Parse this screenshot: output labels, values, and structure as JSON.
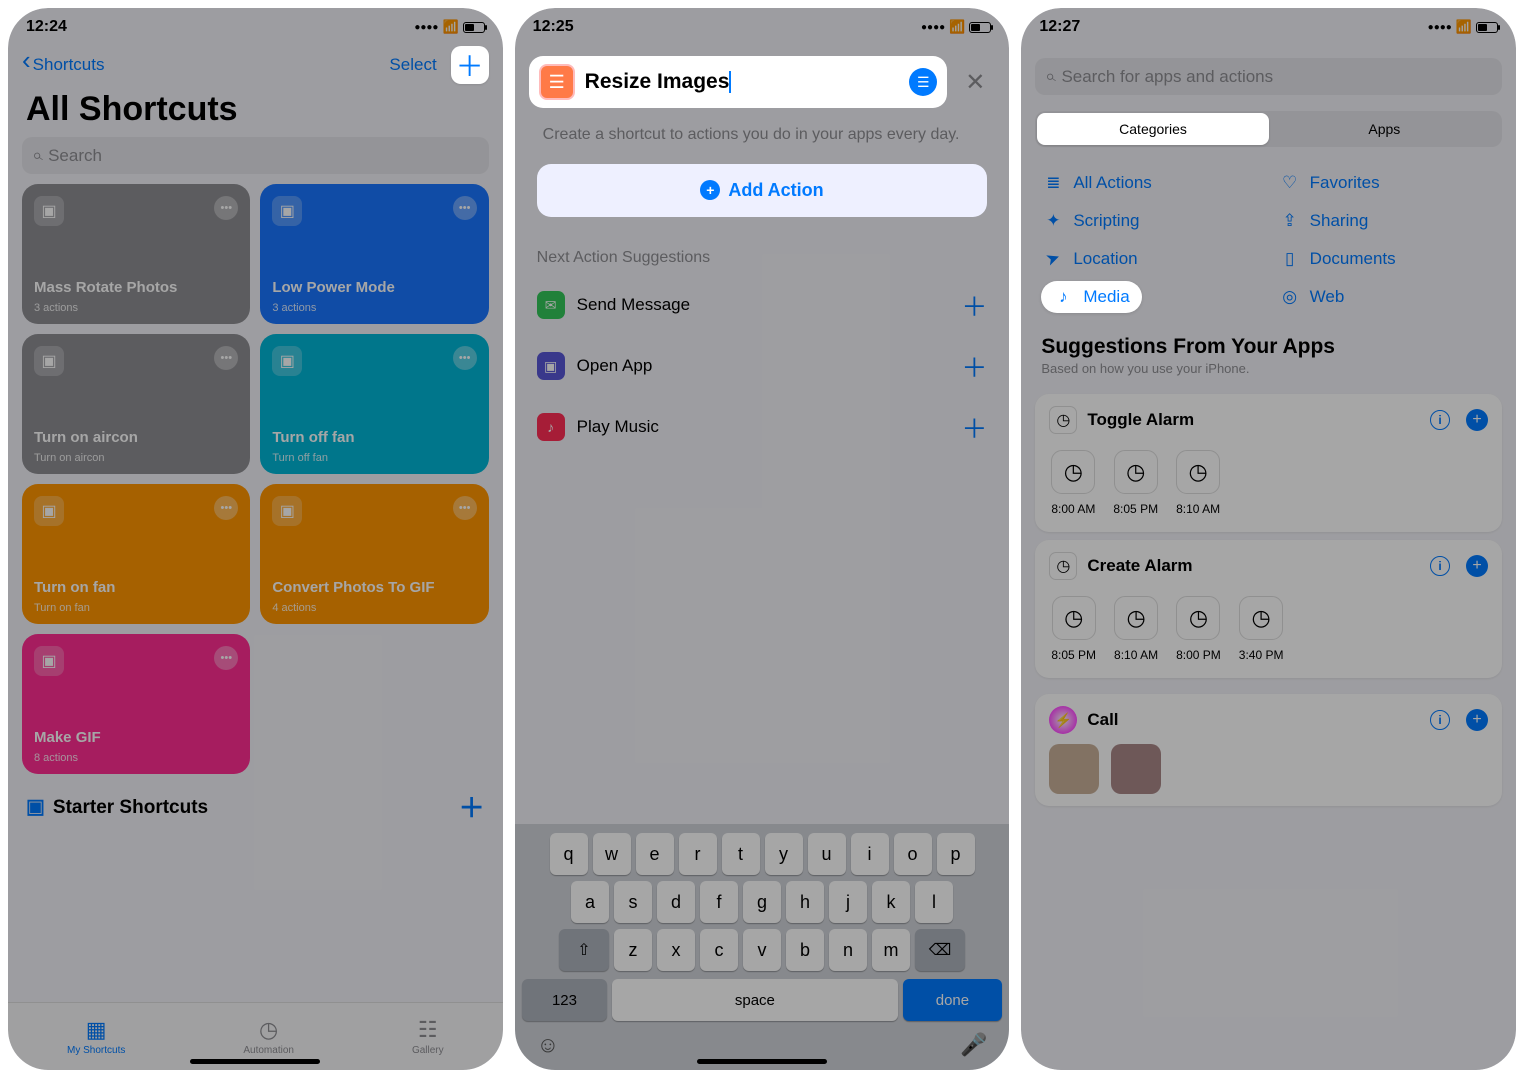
{
  "s1": {
    "time": "12:24",
    "back": "Shortcuts",
    "select": "Select",
    "title": "All Shortcuts",
    "search_ph": "Search",
    "cards": [
      {
        "title": "Mass Rotate Photos",
        "sub": "3 actions",
        "bg": "#8e8e93",
        "icon": "stack"
      },
      {
        "title": "Low Power Mode",
        "sub": "3 actions",
        "bg": "#1976ff",
        "icon": "stack"
      },
      {
        "title": "Turn on aircon",
        "sub": "Turn on aircon",
        "bg": "#8e8e93",
        "icon": "home"
      },
      {
        "title": "Turn off fan",
        "sub": "Turn off fan",
        "bg": "#00b6d6",
        "icon": "home"
      },
      {
        "title": "Turn on fan",
        "sub": "Turn on fan",
        "bg": "#ff9500",
        "icon": "home"
      },
      {
        "title": "Convert Photos To GIF",
        "sub": "4 actions",
        "bg": "#ff9500",
        "icon": "grid"
      },
      {
        "title": "Make GIF",
        "sub": "8 actions",
        "bg": "#ff2d92",
        "icon": "photo"
      }
    ],
    "folder": "Starter Shortcuts",
    "tabs": [
      "My Shortcuts",
      "Automation",
      "Gallery"
    ]
  },
  "s2": {
    "time": "12:25",
    "shortcut_title": "Resize Images",
    "desc": "Create a shortcut to actions you do in your apps every day.",
    "add": "Add Action",
    "next_h": "Next Action Suggestions",
    "suggestions": [
      {
        "label": "Send Message",
        "bg": "#34c759",
        "icon": "✉"
      },
      {
        "label": "Open App",
        "bg": "#5856d6",
        "icon": "▣"
      },
      {
        "label": "Play Music",
        "bg": "#ff2d55",
        "icon": "♪"
      }
    ],
    "kb_rows": [
      [
        "q",
        "w",
        "e",
        "r",
        "t",
        "y",
        "u",
        "i",
        "o",
        "p"
      ],
      [
        "a",
        "s",
        "d",
        "f",
        "g",
        "h",
        "j",
        "k",
        "l"
      ],
      [
        "z",
        "x",
        "c",
        "v",
        "b",
        "n",
        "m"
      ]
    ],
    "k123": "123",
    "space": "space",
    "done": "done"
  },
  "s3": {
    "time": "12:27",
    "search_ph": "Search for apps and actions",
    "segs": [
      "Categories",
      "Apps"
    ],
    "cats": [
      {
        "label": "All Actions",
        "icon": "list-ic"
      },
      {
        "label": "Favorites",
        "icon": "heart-ic"
      },
      {
        "label": "Scripting",
        "icon": "scrpt-ic"
      },
      {
        "label": "Sharing",
        "icon": "share-ic"
      },
      {
        "label": "Location",
        "icon": "loc-ic"
      },
      {
        "label": "Documents",
        "icon": "doc-ic"
      },
      {
        "label": "Media",
        "icon": "media-ic",
        "hi": true
      },
      {
        "label": "Web",
        "icon": "web-ic"
      }
    ],
    "sugg_h": "Suggestions From Your Apps",
    "sugg_sub": "Based on how you use your iPhone.",
    "cards": [
      {
        "title": "Toggle Alarm",
        "chips": [
          "8:00 AM",
          "8:05 PM",
          "8:10 AM"
        ]
      },
      {
        "title": "Create Alarm",
        "chips": [
          "8:05 PM",
          "8:10 AM",
          "8:00 PM",
          "3:40 PM"
        ]
      }
    ],
    "call": "Call"
  }
}
